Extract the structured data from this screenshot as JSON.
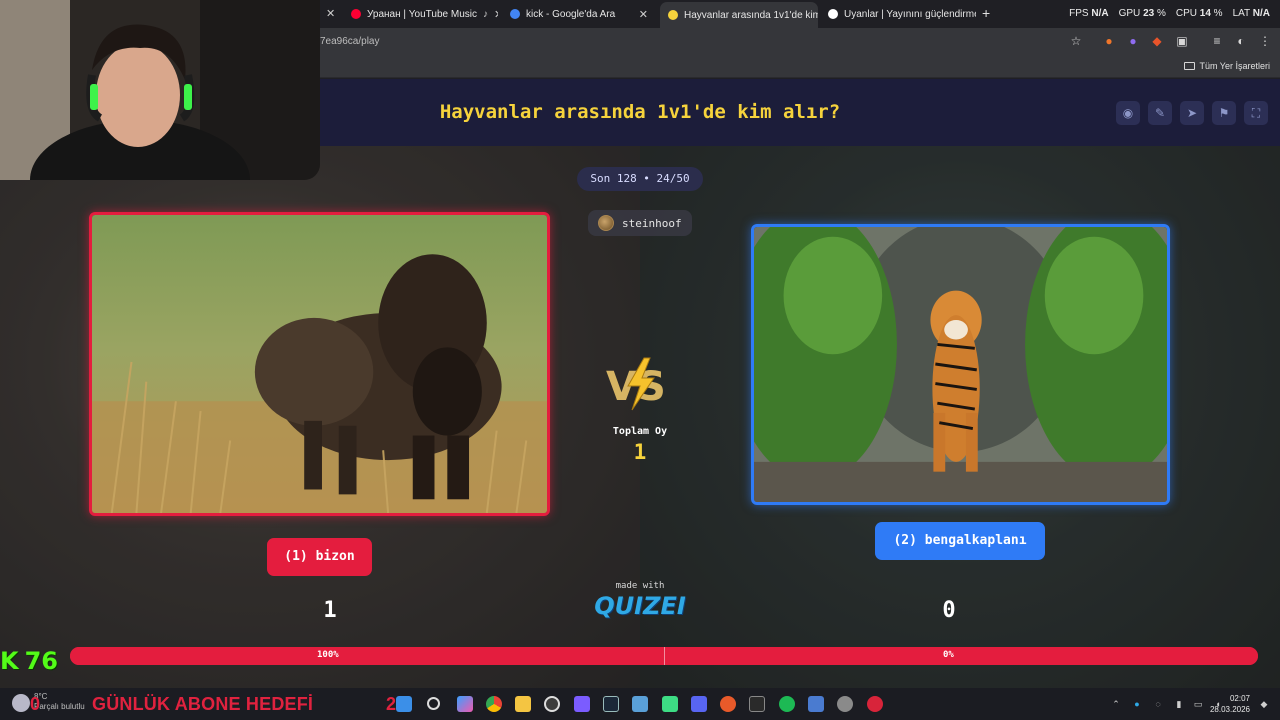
{
  "browser": {
    "tabs": [
      {
        "title": "Уранан | YouTube Music",
        "favicon_color": "#ff0033",
        "active": false
      },
      {
        "title": "kick - Google'da Ara",
        "favicon_color": "#4285f4",
        "active": false
      },
      {
        "title": "Hayvanlar arasında 1v1'de kim",
        "favicon_color": "#f6d33c",
        "active": true
      },
      {
        "title": "Uyanlar | Yayınını güçlendirmek",
        "favicon_color": "#ffffff",
        "active": false
      }
    ],
    "new_tab": "+",
    "url": "7ea96ca/play",
    "perf": {
      "fps_label": "FPS",
      "fps": "N/A",
      "gpu_label": "GPU",
      "gpu": "23",
      "cpu_label": "CPU",
      "cpu": "14",
      "lat_label": "LAT",
      "lat": "N/A"
    },
    "bookmarks_all": "Tüm Yer İşaretleri"
  },
  "page": {
    "title": "Hayvanlar arasında 1v1'de kim alır?",
    "round": "Son 128 • 24/50",
    "username": "steinhoof",
    "total_votes_label": "Toplam Oy",
    "total_votes": "1",
    "vs": "VS",
    "left": {
      "label": "(1) bizon",
      "score": "1",
      "percent": 100,
      "percent_label": "100%"
    },
    "right": {
      "label": "(2) bengalkaplanı",
      "score": "0",
      "percent": 0,
      "percent_label": "0%"
    },
    "made_with": "made with",
    "brand": "QUIZEI",
    "colors": {
      "left": "#e41d3e",
      "right": "#2f7bf6",
      "title": "#f6d33c"
    },
    "header_icons": [
      "eye-icon",
      "edit-icon",
      "send-icon",
      "flag-icon",
      "fullscreen-icon"
    ]
  },
  "overlay": {
    "kick_letter": "K",
    "kick_viewers": "76",
    "goal_prefix": "0",
    "goal_text": "GÜNLÜK ABONE HEDEFİ",
    "goal_num": "2",
    "weather_temp": "8°C",
    "weather_desc": "Parçalı bulutlu"
  },
  "taskbar": {
    "time": "02:07",
    "date": "28.03.2026"
  }
}
